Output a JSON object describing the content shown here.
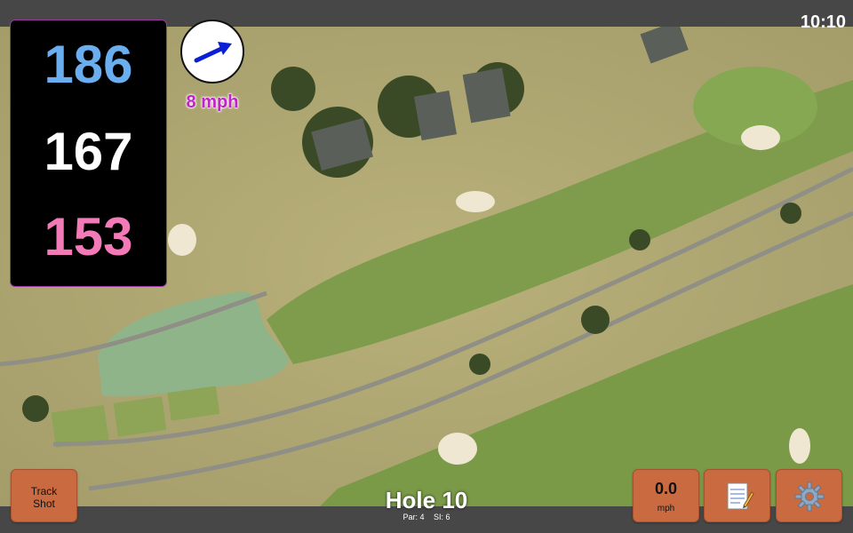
{
  "status_bar": {
    "time": "10:10"
  },
  "yardage": {
    "back": "186",
    "middle": "167",
    "front": "153"
  },
  "wind": {
    "speed": "8 mph",
    "direction_icon": "arrow-east-northeast"
  },
  "hole": {
    "title": "Hole 10",
    "par": "Par: 4",
    "stroke_index": "SI: 6"
  },
  "buttons": {
    "track_shot_line1": "Track",
    "track_shot_line2": "Shot",
    "speed_value": "0.0",
    "speed_unit": "mph",
    "notes_icon": "notepad-icon",
    "settings_icon": "gear-icon"
  },
  "colors": {
    "back_yardage": "#6aaef0",
    "middle_yardage": "#ffffff",
    "front_yardage": "#f27ab6",
    "wind_text": "#c023c8",
    "button_bg": "#c96a40"
  }
}
